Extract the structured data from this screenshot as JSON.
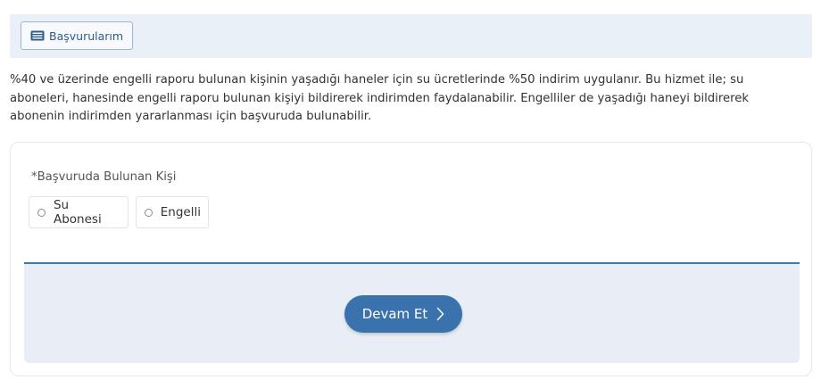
{
  "toolbar": {
    "applications_label": "Başvurularım",
    "applications_icon": "list-card-icon"
  },
  "info": {
    "text": "%40 ve üzerinde engelli raporu bulunan kişinin yaşadığı haneler için su ücretlerinde %50 indirim uygulanır. Bu hizmet ile; su aboneleri, hanesinde engelli raporu bulunan kişiyi bildirerek indirimden faydalanabilir. Engelliler de yaşadığı haneyi bildirerek abonenin indirimden yararlanması için başvuruda bulunabilir."
  },
  "form": {
    "applicant_label": "*Başvuruda Bulunan Kişi",
    "options": [
      {
        "label": "Su Abonesi",
        "selected": false
      },
      {
        "label": "Engelli",
        "selected": false
      }
    ],
    "continue_label": "Devam Et",
    "continue_icon": "chevron-right-icon"
  },
  "colors": {
    "accent": "#3a72ad",
    "panel_bg": "#e9eef6",
    "topbar_bg": "#eaf0f8"
  }
}
